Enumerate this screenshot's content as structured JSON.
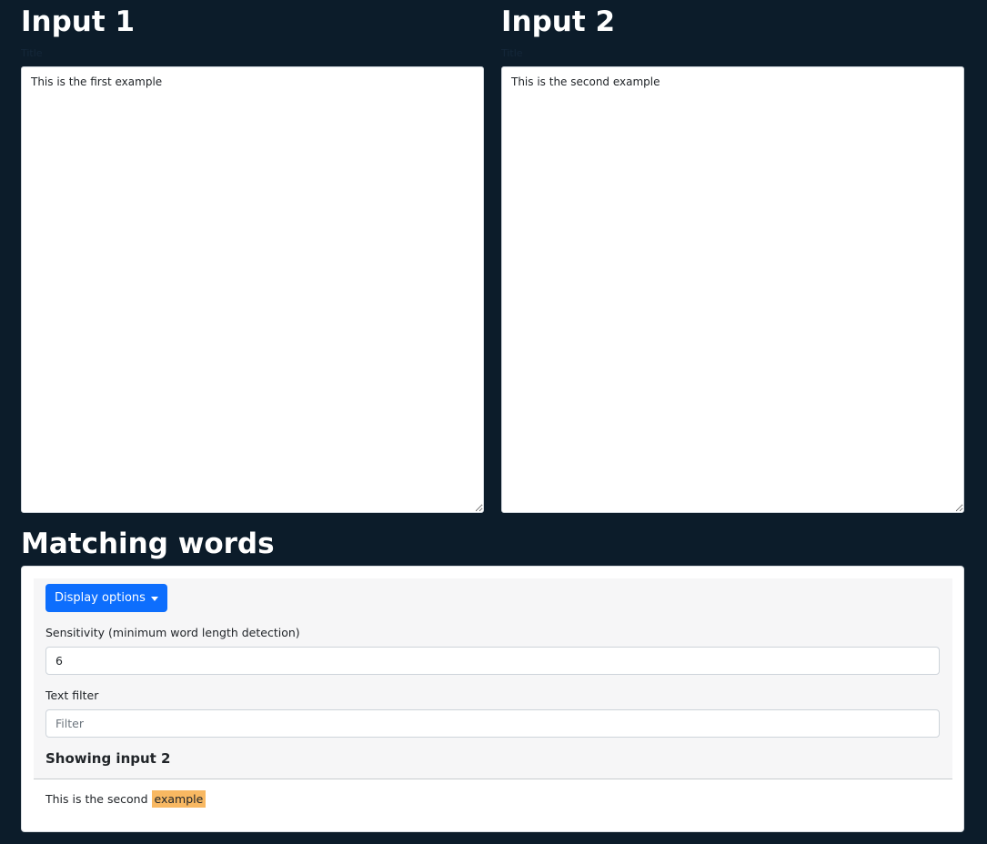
{
  "inputs": [
    {
      "heading": "Input 1",
      "title_label": "Title",
      "text": "This is the first example"
    },
    {
      "heading": "Input 2",
      "title_label": "Title",
      "text": "This is the second example"
    }
  ],
  "matching": {
    "heading": "Matching words",
    "display_options_label": "Display options",
    "sensitivity": {
      "label": "Sensitivity (minimum word length detection)",
      "value": "6"
    },
    "filter": {
      "label": "Text filter",
      "value": "",
      "placeholder": "Filter"
    },
    "showing_label": "Showing input 2",
    "result": {
      "prefix": "This is the second ",
      "highlight": "example"
    }
  },
  "colors": {
    "page_background": "#0c1c2a",
    "primary_button": "#0d6efd",
    "highlight": "#f8b862",
    "panel_background": "#f6f6f7"
  },
  "icons": {
    "dropdown": "caret-down-icon"
  }
}
